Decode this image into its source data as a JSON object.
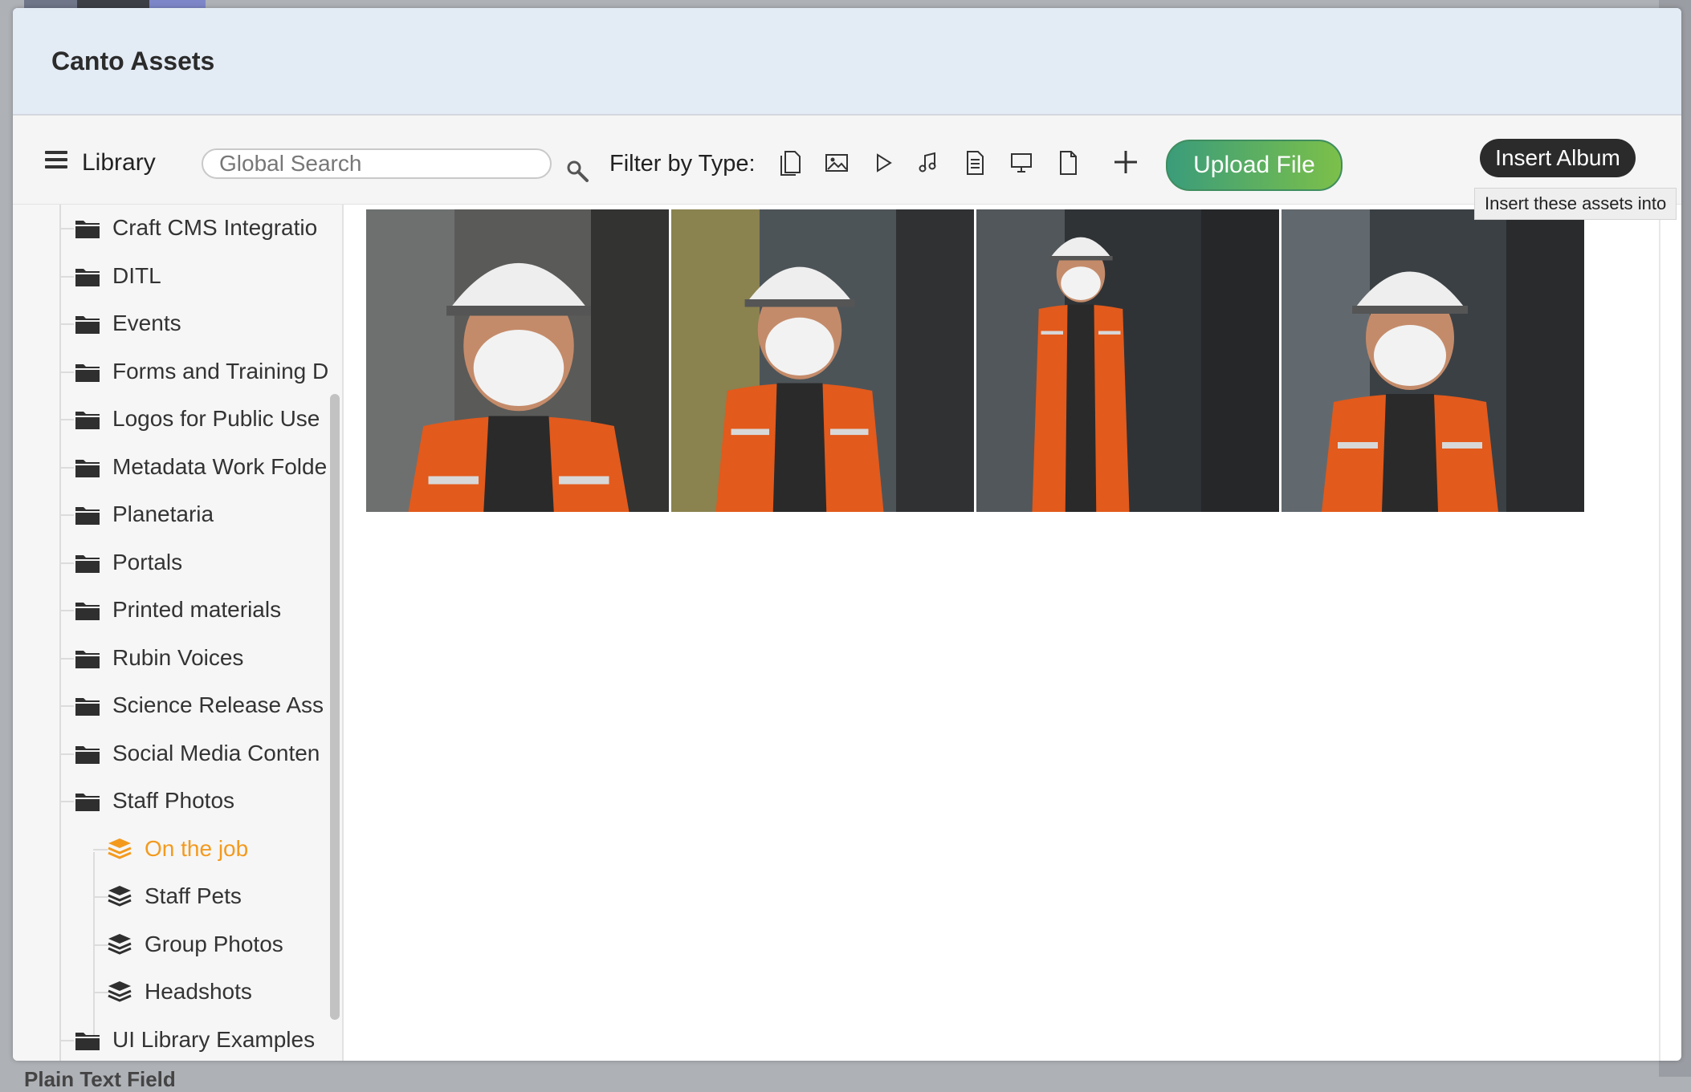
{
  "modal": {
    "title": "Canto Assets"
  },
  "toolbar": {
    "library_label": "Library",
    "search_placeholder": "Global Search",
    "search_value": "",
    "filter_label": "Filter by Type:",
    "filter_types": [
      "document",
      "image",
      "video",
      "audio",
      "text",
      "presentation",
      "other"
    ],
    "upload_label": "Upload File",
    "insert_label": "Insert Album",
    "insert_tooltip": "Insert these assets into",
    "colors": {
      "upload_gradient_start": "#3a9c7a",
      "upload_gradient_end": "#7cc04a",
      "insert_bg": "#2b2b2b"
    }
  },
  "sidebar": {
    "folders": [
      {
        "label": "Craft CMS Integratio"
      },
      {
        "label": "DITL"
      },
      {
        "label": "Events"
      },
      {
        "label": "Forms and Training D"
      },
      {
        "label": "Logos for Public Use"
      },
      {
        "label": "Metadata Work Folde"
      },
      {
        "label": "Planetaria"
      },
      {
        "label": "Portals"
      },
      {
        "label": "Printed materials"
      },
      {
        "label": "Rubin Voices"
      },
      {
        "label": "Science Release Ass"
      },
      {
        "label": "Social Media Conten"
      },
      {
        "label": "Staff Photos"
      }
    ],
    "albums": [
      {
        "label": "On the job",
        "active": true
      },
      {
        "label": "Staff Pets"
      },
      {
        "label": "Group Photos"
      },
      {
        "label": "Headshots"
      }
    ],
    "last_folder": {
      "label": "UI Library Examples"
    },
    "active_color": "#f39a1e"
  },
  "content": {
    "assets": [
      {
        "name": "staff-photo-1"
      },
      {
        "name": "staff-photo-2"
      },
      {
        "name": "staff-photo-3"
      },
      {
        "name": "staff-photo-4"
      }
    ]
  },
  "background": {
    "bottom_text": "Plain Text Field"
  }
}
